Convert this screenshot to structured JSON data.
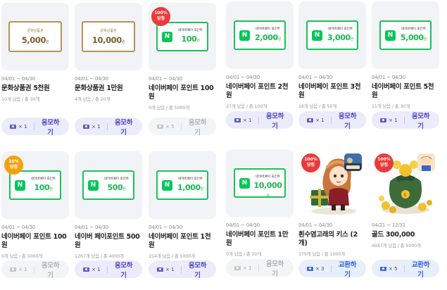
{
  "colors": {
    "accent_purple": "#4a46c8",
    "accent_blue": "#2f63e0",
    "naver_green": "#03c75a",
    "gold": "#b69256",
    "badge_red": "#e93a3a",
    "badge_orange": "#f4a111"
  },
  "cards": [
    {
      "date": "04/01 ~ 04/30",
      "title": "문화상품권 5천원",
      "stock": "10개 남음 / 총 30개",
      "tickets": "× 1",
      "button": "응모하기",
      "voucher_label": "문화상품권",
      "amount": "5,000",
      "unit": "원"
    },
    {
      "date": "04/01 ~ 04/30",
      "title": "문화상품권 1만원",
      "stock": "4개 남음 / 총 20개",
      "tickets": "× 1",
      "button": "응모하기",
      "voucher_label": "문화상품권",
      "amount": "10,000",
      "unit": "원"
    },
    {
      "date": "04/01 ~ 04/30",
      "title": "네이버페이 포인트 100원",
      "stock": "0개 남음 / 총 5000개",
      "tickets": "× 5",
      "button": "응모하기",
      "badge": [
        "100%",
        "당첨"
      ],
      "card_label": "네이버페이 포인트",
      "amount": "100",
      "unit": "원"
    },
    {
      "date": "04/01 ~ 04/30",
      "title": "네이버페이 포인트 2천원",
      "stock": "27개 남음 / 총 100개",
      "tickets": "× 1",
      "button": "응모하기",
      "card_label": "네이버페이 포인트",
      "amount": "2,000",
      "unit": "원"
    },
    {
      "date": "04/01 ~ 04/30",
      "title": "네이버페이 포인트 3천원",
      "stock": "16개 남음 / 총 50개",
      "tickets": "× 1",
      "button": "응모하기",
      "card_label": "네이버페이 포인트",
      "amount": "3,000",
      "unit": "원"
    },
    {
      "date": "04/01 ~ 04/30",
      "title": "네이버페이 포인트 5천원",
      "stock": "11개 남음 / 총 30개",
      "tickets": "× 1",
      "button": "응모하기",
      "card_label": "네이버페이 포인트",
      "amount": "5,000",
      "unit": "원"
    },
    {
      "date": "04/01 ~ 04/30",
      "title": "네이버페이 포인트 100원",
      "stock": "0개 남음 / 총 5000개",
      "tickets": "× 1",
      "button": "응모하기",
      "badge": [
        "20%",
        "당첨"
      ],
      "card_label": "네이버페이 포인트",
      "amount": "100",
      "unit": "원"
    },
    {
      "date": "04/01 ~ 04/30",
      "title": "네이버 페이포인트 500원",
      "stock": "1267개 남음 / 총 4000개",
      "tickets": "× 1",
      "button": "응모하기",
      "card_label": "네이버페이 포인트",
      "amount": "500",
      "unit": "원"
    },
    {
      "date": "04/01 ~ 04/30",
      "title": "네이버페이 포인트 1천원",
      "stock": "154개 남음 / 총 1000개",
      "tickets": "× 1",
      "button": "응모하기",
      "card_label": "네이버페이 포인트",
      "amount": "1,000",
      "unit": "원"
    },
    {
      "date": "04/01 ~ 04/30",
      "title": "네이버페이 포인트 1만원",
      "stock": "0개 남음 / 총 20개",
      "tickets": "× 1",
      "button": "응모하기",
      "card_label": "네이버페이 포인트",
      "amount": "10,000",
      "unit": "원"
    },
    {
      "date": "04/01 ~ 04/30",
      "title": "흰수염고래의 키스 (2개)",
      "stock": "379개 남음 / 총 1000개",
      "tickets": "× 3",
      "button": "교환하기",
      "badge": [
        "100%",
        "당첨"
      ],
      "game_label": "LINE"
    },
    {
      "date": "04/21 ~ 12/31",
      "title": "골드 300,000",
      "stock": "4947개 남음 / 총 5000개",
      "tickets": "× 5",
      "button": "교환하기",
      "badge": [
        "100%",
        "당첨"
      ]
    }
  ]
}
